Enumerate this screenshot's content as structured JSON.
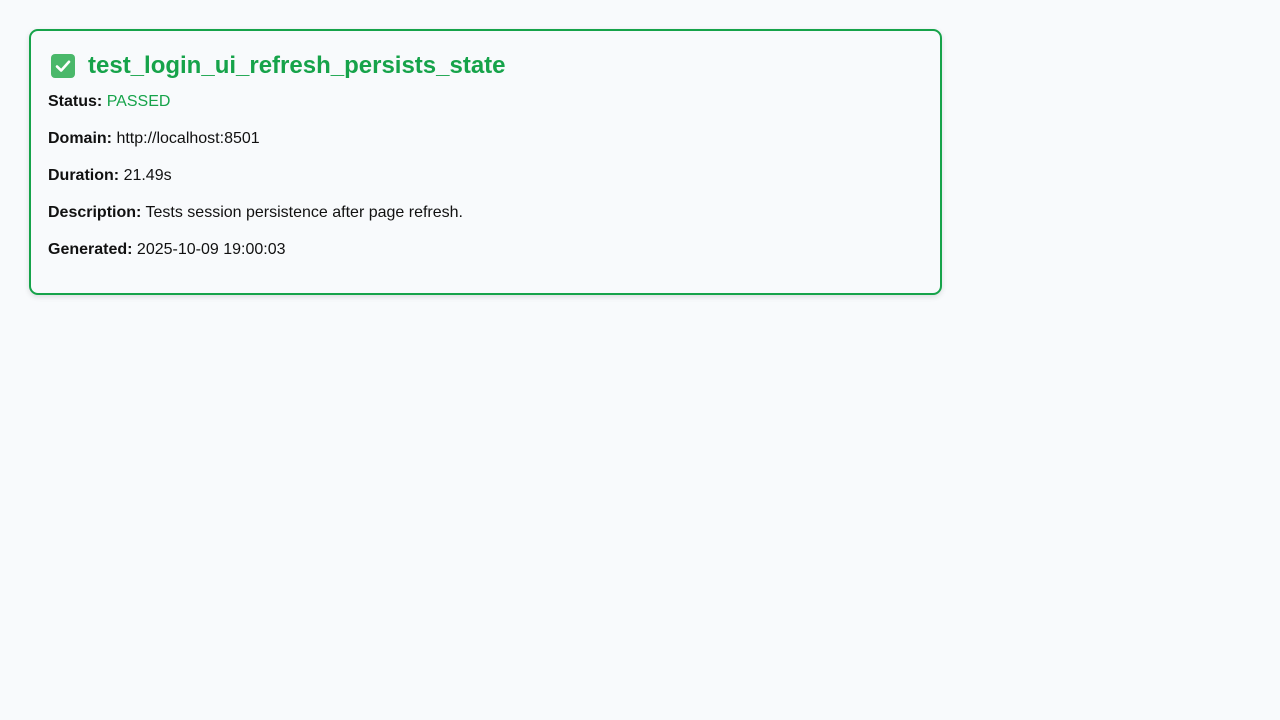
{
  "report": {
    "title": "test_login_ui_refresh_persists_state",
    "status_icon": "check-icon",
    "accent_color": "#16a34a",
    "fields": {
      "status": {
        "label": "Status:",
        "value": "PASSED"
      },
      "domain": {
        "label": "Domain:",
        "value": "http://localhost:8501"
      },
      "duration": {
        "label": "Duration:",
        "value": "21.49s"
      },
      "description": {
        "label": "Description:",
        "value": "Tests session persistence after page refresh."
      },
      "generated": {
        "label": "Generated:",
        "value": "2025-10-09 19:00:03"
      }
    }
  }
}
